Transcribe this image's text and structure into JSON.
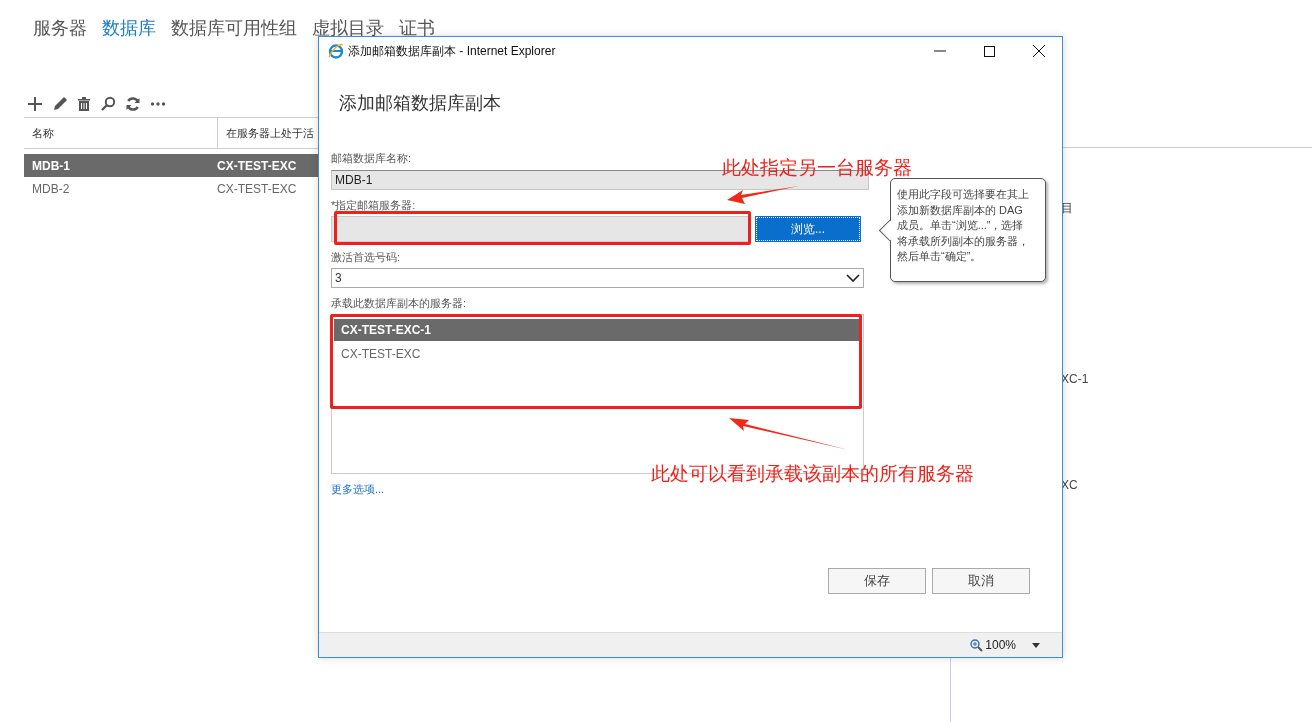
{
  "nav": {
    "tabs": [
      {
        "label": "服务器",
        "selected": false
      },
      {
        "label": "数据库",
        "selected": true
      },
      {
        "label": "数据库可用性组",
        "selected": false
      },
      {
        "label": "虚拟目录",
        "selected": false
      },
      {
        "label": "证书",
        "selected": false
      }
    ]
  },
  "table": {
    "columns": [
      "名称",
      "在服务器上处于活"
    ],
    "rows": [
      {
        "cells": [
          "MDB-1",
          "CX-TEST-EXC"
        ],
        "selected": true
      },
      {
        "cells": [
          "MDB-2",
          "CX-TEST-EXC"
        ],
        "selected": false
      }
    ]
  },
  "detail_pane": {
    "fragments": [
      "目",
      "XC-1",
      "XC"
    ]
  },
  "dialog": {
    "window_title": "添加邮箱数据库副本 - Internet Explorer",
    "heading": "添加邮箱数据库副本",
    "database_name": {
      "label": "邮箱数据库名称:",
      "value": "MDB-1",
      "disabled": true
    },
    "server_field": {
      "label": "*指定邮箱服务器:",
      "button": "浏览..."
    },
    "activation": {
      "label": "激活首选号码:",
      "value": "3"
    },
    "hosting_servers": {
      "label": "承载此数据库副本的服务器:",
      "items": [
        {
          "name": "CX-TEST-EXC-1",
          "selected": true
        },
        {
          "name": "CX-TEST-EXC",
          "selected": false
        }
      ]
    },
    "more_link": "更多选项...",
    "buttons": [
      "保存",
      "取消"
    ],
    "zoom": "100%",
    "tooltip": "使用此字段可选择要在其上添加新数据库副本的 DAG 成员。单击“浏览...”，选择将承载所列副本的服务器，然后单击“确定”。"
  },
  "annotations": {
    "server_note": "此处指定另一台服务器",
    "list_note": "此处可以看到承载该副本的所有服务器"
  }
}
